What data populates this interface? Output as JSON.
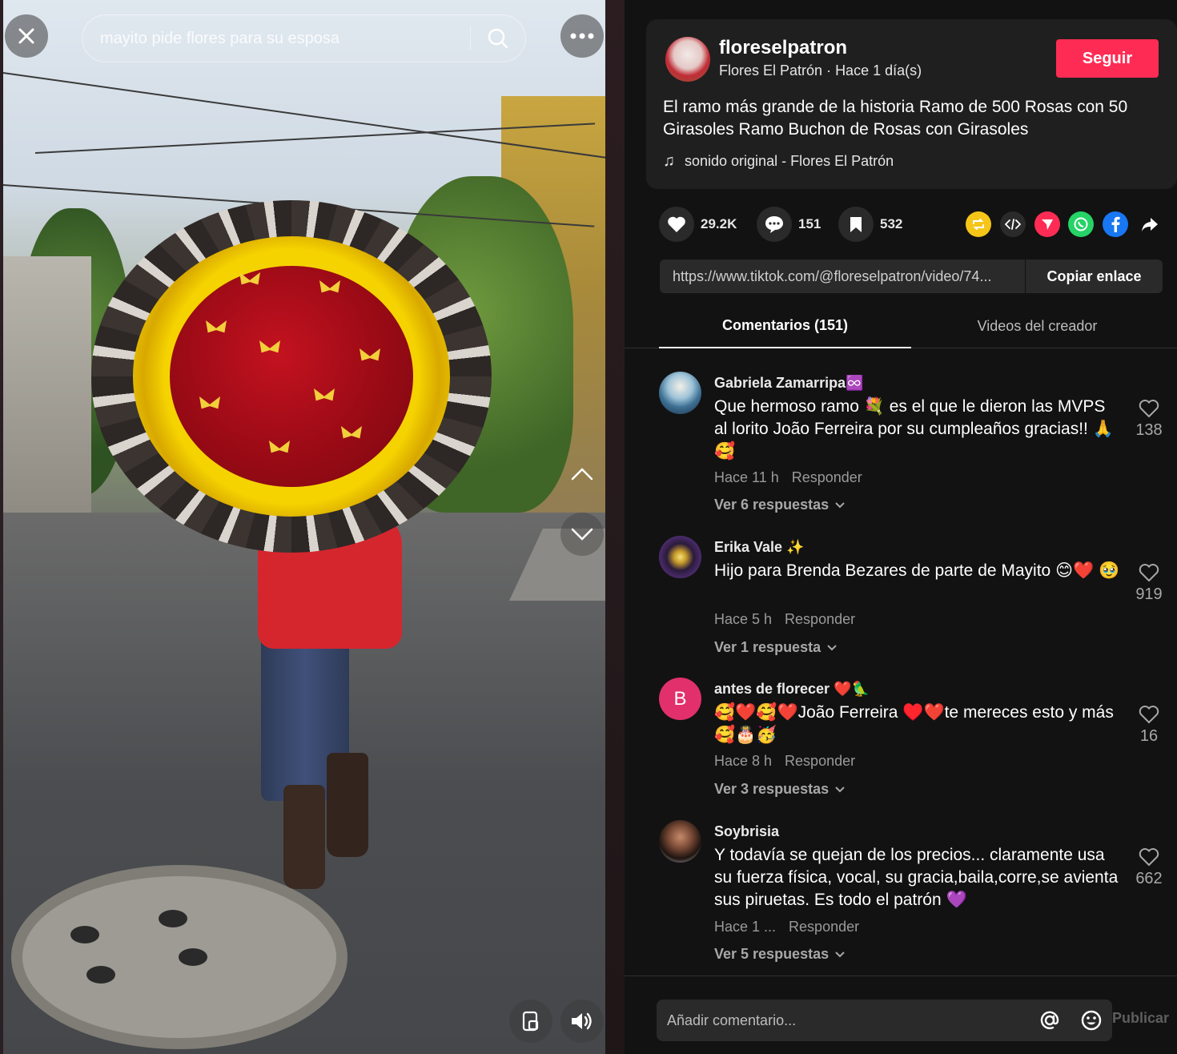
{
  "video": {
    "search_query": "mayito pide flores para su esposa",
    "icons": {
      "close": "close-icon",
      "search": "search-icon",
      "more": "more-dots-icon",
      "up": "chevron-up-icon",
      "down": "chevron-down-icon",
      "miniplayer": "miniplayer-icon",
      "volume": "volume-icon"
    }
  },
  "author": {
    "username": "floreselpatron",
    "display_name": "Flores El Patrón",
    "separator": " · ",
    "posted": "Hace 1 día(s)",
    "follow_label": "Seguir"
  },
  "post": {
    "description": "El ramo más grande de la historia Ramo de 500 Rosas con 50 Girasoles Ramo Buchon de Rosas con Girasoles",
    "music_icon": "♫",
    "music": "sonido original - Flores El Patrón"
  },
  "actions": {
    "likes": "29.2K",
    "comments": "151",
    "saves": "532",
    "share_icons": [
      "repost-icon",
      "embed-icon",
      "send-icon",
      "whatsapp-icon",
      "facebook-icon",
      "share-arrow-icon"
    ],
    "share_colors": [
      "#f5c518",
      "#2a2a2a",
      "#fe2c55",
      "#25d366",
      "#1877f2",
      "#121212"
    ]
  },
  "link": {
    "url": "https://www.tiktok.com/@floreselpatron/video/74...",
    "copy_label": "Copiar enlace"
  },
  "tabs": {
    "comments_label": "Comentarios (151)",
    "creator_label": "Videos del creador"
  },
  "comments": [
    {
      "user": "Gabriela Zamarripa♾️",
      "text": "Que hermoso ramo 💐 es el que le dieron las MVPS al lorito João Ferreira por su cumpleaños gracias!! 🙏🥰",
      "time": "Hace 11 h",
      "reply_label": "Responder",
      "replies": "Ver 6 respuestas",
      "likes": "138",
      "avatar_letter": ""
    },
    {
      "user": "Erika Vale ✨",
      "text": "Hijo para Brenda Bezares de parte de Mayito 😊❤️ 🥹",
      "time": "Hace 5 h",
      "reply_label": "Responder",
      "replies": "Ver 1 respuesta",
      "likes": "919",
      "avatar_letter": ""
    },
    {
      "user": "antes de florecer ❤️🦜",
      "text": "🥰❤️🥰❤️João Ferreira ♥️❤️te mereces esto y más 🥰🎂🥳",
      "time": "Hace 8 h",
      "reply_label": "Responder",
      "replies": "Ver 3 respuestas",
      "likes": "16",
      "avatar_letter": "B"
    },
    {
      "user": "Soybrisia",
      "text": "Y todavía se quejan de los precios... claramente usa su fuerza física, vocal, su gracia,baila,corre,se avienta sus piruetas. Es todo el patrón 💜",
      "time": "Hace 1 ...",
      "reply_label": "Responder",
      "replies": "Ver 5 respuestas",
      "likes": "662",
      "avatar_letter": ""
    }
  ],
  "composer": {
    "placeholder": "Añadir comentario...",
    "publish_label": "Publicar"
  },
  "colors": {
    "accent": "#fe2c55",
    "background": "#121212",
    "card": "#1f1f1f",
    "avatar_b": "#e1306c"
  }
}
